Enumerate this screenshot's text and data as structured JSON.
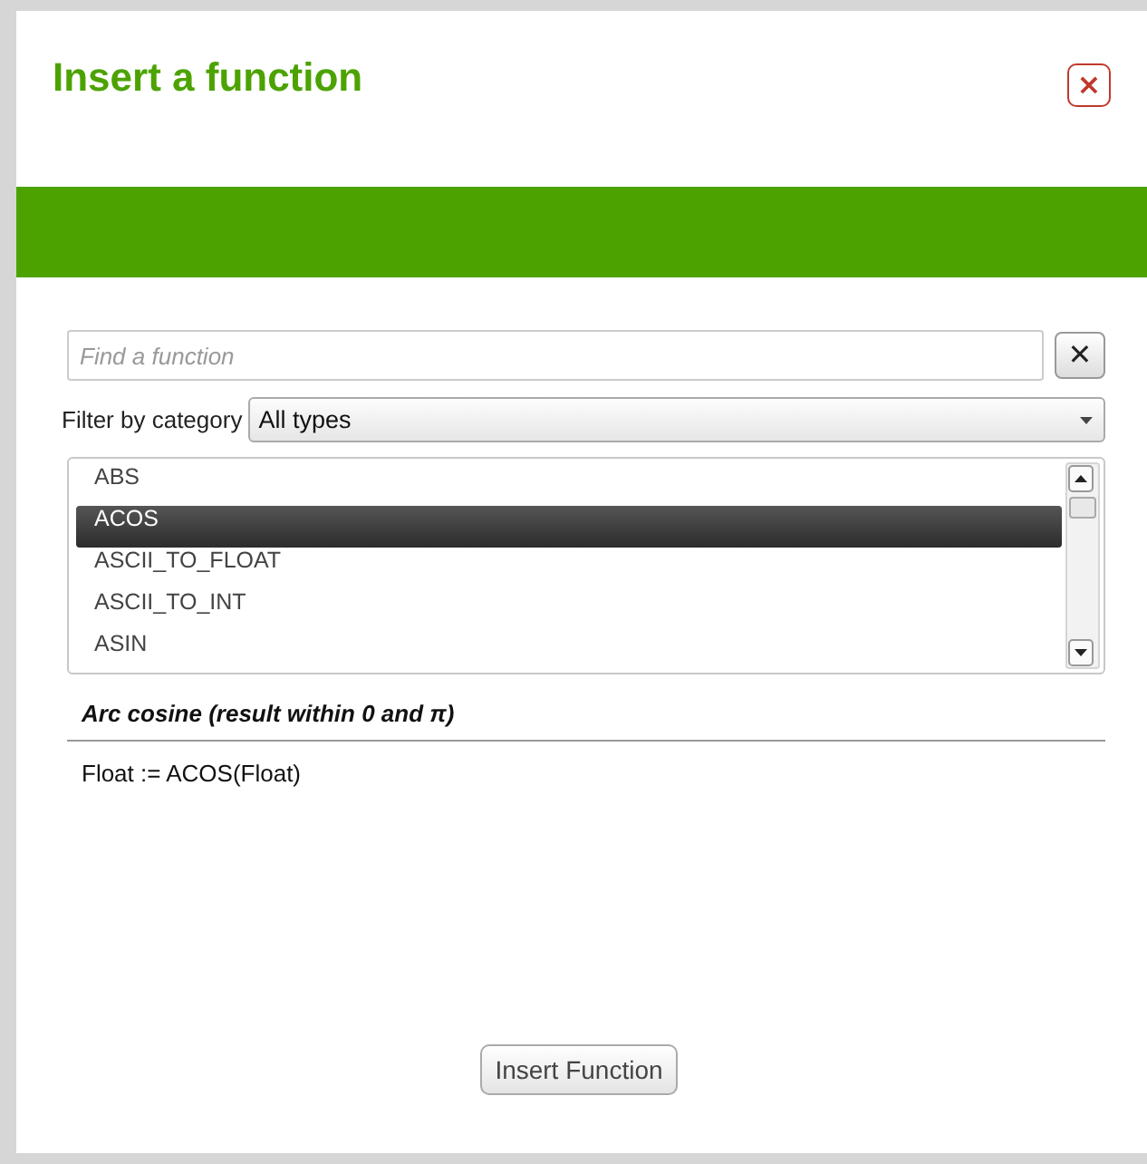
{
  "window": {
    "title": "Insert a function",
    "close_icon": "×"
  },
  "search": {
    "placeholder": "Find a function",
    "clear_icon": "✕"
  },
  "filter": {
    "label": "Filter by category",
    "value": "All types"
  },
  "functions": [
    {
      "name": "ABS",
      "selected": false
    },
    {
      "name": "ACOS",
      "selected": true
    },
    {
      "name": "ASCII_TO_FLOAT",
      "selected": false
    },
    {
      "name": "ASCII_TO_INT",
      "selected": false
    },
    {
      "name": "ASIN",
      "selected": false
    }
  ],
  "description": "Arc cosine (result within 0 and π)",
  "syntax": "Float := ACOS(Float)",
  "buttons": [
    "Insert Function"
  ]
}
